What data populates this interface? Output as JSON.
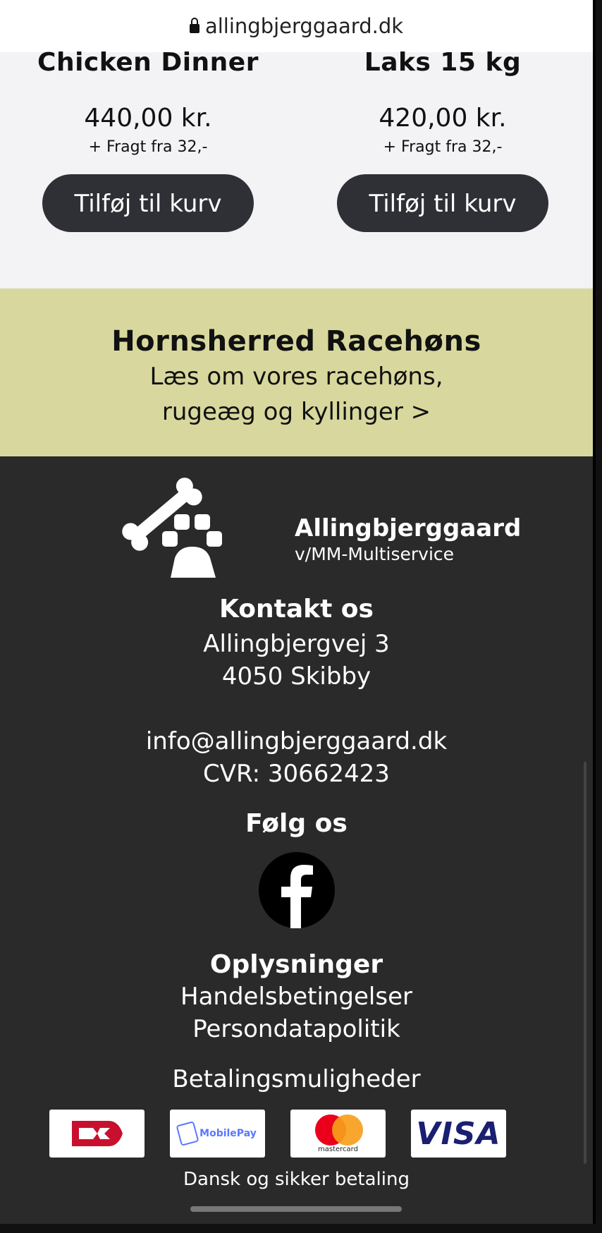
{
  "browser": {
    "url": "allingbjerggaard.dk"
  },
  "products": [
    {
      "name": "Chicken Dinner",
      "price": "440,00 kr.",
      "shipping": "+ Fragt fra 32,-",
      "button": "Tilføj til kurv"
    },
    {
      "name": "Laks 15 kg",
      "price": "420,00 kr.",
      "shipping": "+ Fragt fra 32,-",
      "button": "Tilføj til kurv"
    }
  ],
  "banner": {
    "title": "Hornsherred Racehøns",
    "line1": "Læs om vores racehøns,",
    "line2": "rugeæg og kyllinger >"
  },
  "footer": {
    "brand_name": "Allingbjerggaard",
    "brand_sub": "v/MM-Multiservice",
    "contact_heading": "Kontakt os",
    "address1": "Allingbjergvej 3",
    "address2": "4050 Skibby",
    "email": "info@allingbjerggaard.dk",
    "cvr": "CVR: 30662423",
    "follow_heading": "Følg os",
    "info_heading": "Oplysninger",
    "link_terms": "Handelsbetingelser",
    "link_privacy": "Persondatapolitik",
    "payment_heading": "Betalingsmuligheder",
    "payment_note": "Dansk og sikker betaling",
    "payment_labels": {
      "mobilepay": "MobilePay",
      "mastercard": "mastercard",
      "visa": "VISA"
    }
  },
  "colors": {
    "banner": "#d8d89e",
    "footer": "#2a2a2a",
    "button": "#2f3035",
    "products_bg": "#f3f2f5"
  },
  "icons": [
    "lock-icon",
    "bone-paw-logo-icon",
    "facebook-icon",
    "dankort-icon",
    "mobilepay-icon",
    "mastercard-icon",
    "visa-icon"
  ]
}
